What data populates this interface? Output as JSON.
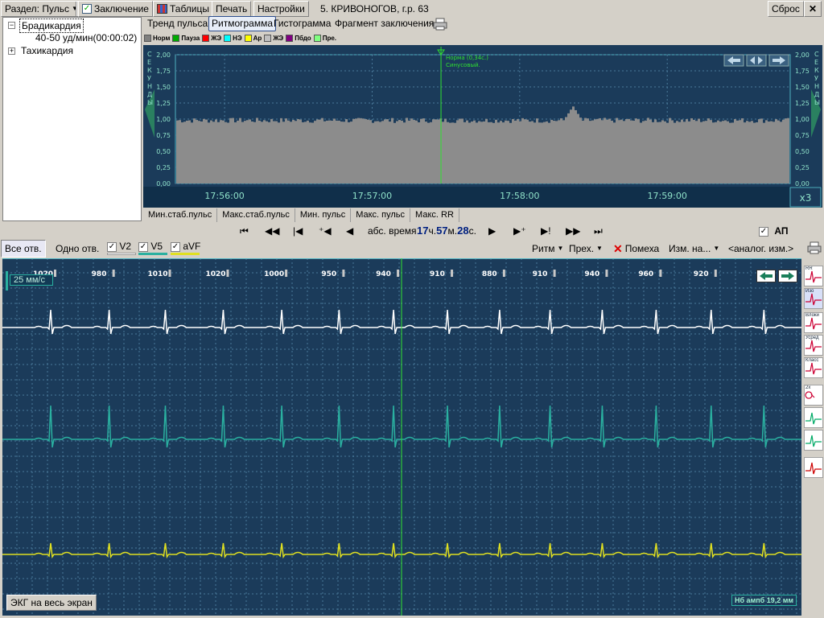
{
  "toolbar": {
    "section_label": "Раздел: Пульс",
    "conclusion_label": "Заключение",
    "tables_label": "Таблицы",
    "print_label": "Печать",
    "settings_label": "Настройки",
    "patient": "5. КРИВОНОГОВ, г.р. 63",
    "reset_label": "Сброс"
  },
  "tree": {
    "items": [
      {
        "label": "Брадикардия",
        "expanded": true
      },
      {
        "label": "40-50 уд/мин(00:00:02)"
      },
      {
        "label": "Тахикардия",
        "expanded": false
      }
    ]
  },
  "tabs": [
    "Тренд пульса",
    "Ритмограмма",
    "Гистограмма",
    "Фрагмент заключения"
  ],
  "legend": [
    {
      "label": "Норм",
      "color": "#808080"
    },
    {
      "label": "Пауза",
      "color": "#00aa00"
    },
    {
      "label": "ЖЭ",
      "color": "#ff0000"
    },
    {
      "label": "НЭ",
      "color": "#00ffff"
    },
    {
      "label": "Ар",
      "color": "#ffff00"
    },
    {
      "label": "ЖЭ",
      "color": "#c0c0c0"
    },
    {
      "label": "Пбдо",
      "color": "#800080"
    },
    {
      "label": "Пре.",
      "color": "#80ff80"
    }
  ],
  "rhythmogram": {
    "y_axis_label": "СЕКУНДЫ",
    "y_ticks": [
      "2,00",
      "1,75",
      "1,50",
      "1,25",
      "1,00",
      "0,75",
      "0,50",
      "0,25",
      "0,00"
    ],
    "x_ticks": [
      "17:56:00",
      "17:57:00",
      "17:58:00",
      "17:59:00"
    ],
    "marker_text_1": "Норма (0,34с.)",
    "marker_text_2": "Синусовый.",
    "zoom": "x3"
  },
  "rhythm_tabs": [
    "Мин.стаб.пульс",
    "Макс.стаб.пульс",
    "Мин. пульс",
    "Макс. пульс",
    "Макс. RR"
  ],
  "nav": {
    "abs_time_label": "абс. время",
    "hours": "17",
    "h_unit": "ч.",
    "minutes": "57",
    "m_unit": "м.",
    "seconds": "28",
    "s_unit": "с.",
    "ap_label": "АП"
  },
  "ecg_toolbar": {
    "all_leads": "Все отв.",
    "one_lead": "Одно отв.",
    "leads": [
      {
        "label": "V2",
        "color": "#ffffff"
      },
      {
        "label": "V5",
        "color": "#2ab0a0"
      },
      {
        "label": "aVF",
        "color": "#e0e020"
      }
    ],
    "rhythm": "Ритм",
    "prex": "Прех.",
    "noise": "Помеха",
    "measure": "Изм. на...",
    "analog": "<аналог. изм.>"
  },
  "ecg": {
    "speed": "25 мм/с",
    "rr_values": [
      "1020",
      "980",
      "1010",
      "1020",
      "1000",
      "950",
      "940",
      "910",
      "880",
      "910",
      "940",
      "960",
      "920"
    ],
    "fullscreen": "ЭКГ на весь экран",
    "status": "Нб ампб 19,2 мм"
  },
  "side_icons": [
    "RR",
    "Изо",
    "Влоки",
    "Усред",
    "Класс",
    "2х",
    "",
    "",
    ""
  ],
  "rhythm_data": {
    "x_range": [
      "17:55:40",
      "17:59:50"
    ],
    "y_range": [
      0,
      2
    ],
    "typical_rr": 0.98
  }
}
